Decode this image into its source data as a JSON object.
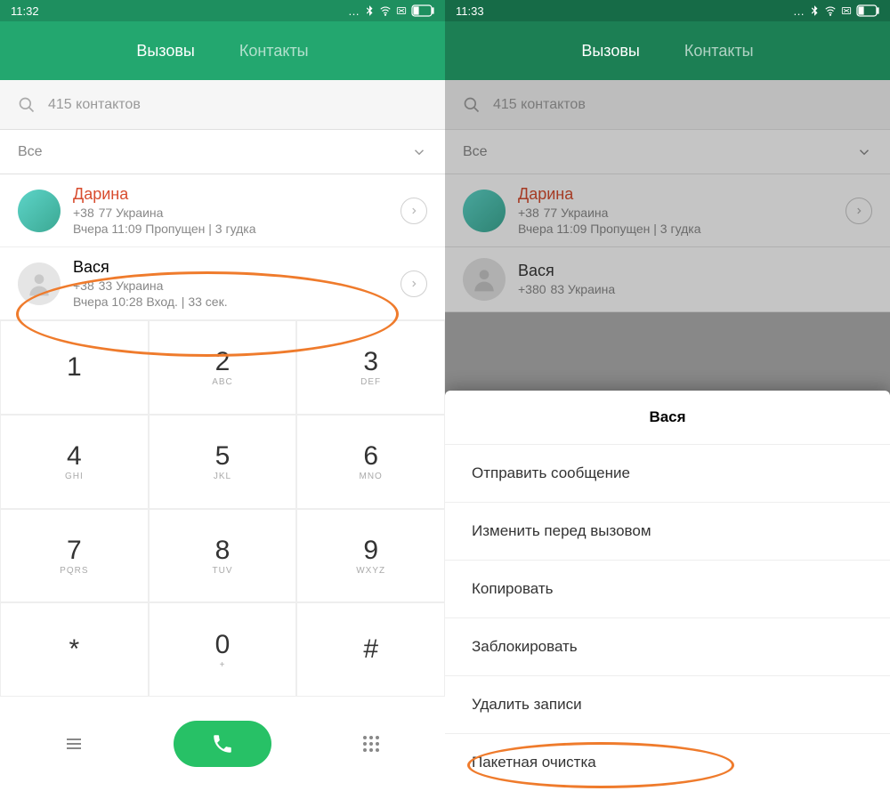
{
  "left": {
    "status_time": "11:32",
    "tabs": {
      "calls": "Вызовы",
      "contacts": "Контакты"
    },
    "search_placeholder": "415 контактов",
    "filter": "Все",
    "entries": [
      {
        "name": "Дарина",
        "phone_pre": "+38",
        "phone_post": "77  Украина",
        "meta": "Вчера 11:09 Пропущен | 3 гудка",
        "missed": true
      },
      {
        "name": "Вася",
        "phone_pre": "+38",
        "phone_post": "33  Украина",
        "meta": "Вчера 10:28 Вход. | 33 сек.",
        "missed": false
      }
    ],
    "dialpad": [
      {
        "num": "1",
        "let": ""
      },
      {
        "num": "2",
        "let": "ABC"
      },
      {
        "num": "3",
        "let": "DEF"
      },
      {
        "num": "4",
        "let": "GHI"
      },
      {
        "num": "5",
        "let": "JKL"
      },
      {
        "num": "6",
        "let": "MNO"
      },
      {
        "num": "7",
        "let": "PQRS"
      },
      {
        "num": "8",
        "let": "TUV"
      },
      {
        "num": "9",
        "let": "WXYZ"
      },
      {
        "num": "*",
        "let": ""
      },
      {
        "num": "0",
        "let": "+"
      },
      {
        "num": "#",
        "let": ""
      }
    ]
  },
  "right": {
    "status_time": "11:33",
    "tabs": {
      "calls": "Вызовы",
      "contacts": "Контакты"
    },
    "search_placeholder": "415 контактов",
    "filter": "Все",
    "entries": [
      {
        "name": "Дарина",
        "phone_pre": "+38",
        "phone_post": "77  Украина",
        "meta": "Вчера 11:09 Пропущен | 3 гудка",
        "missed": true
      },
      {
        "name": "Вася",
        "phone_pre": "+380",
        "phone_post": "83  Украина",
        "meta": "",
        "missed": false
      }
    ],
    "context": {
      "title": "Вася",
      "items": [
        "Отправить сообщение",
        "Изменить перед вызовом",
        "Копировать",
        "Заблокировать",
        "Удалить записи",
        "Пакетная очистка"
      ]
    }
  }
}
